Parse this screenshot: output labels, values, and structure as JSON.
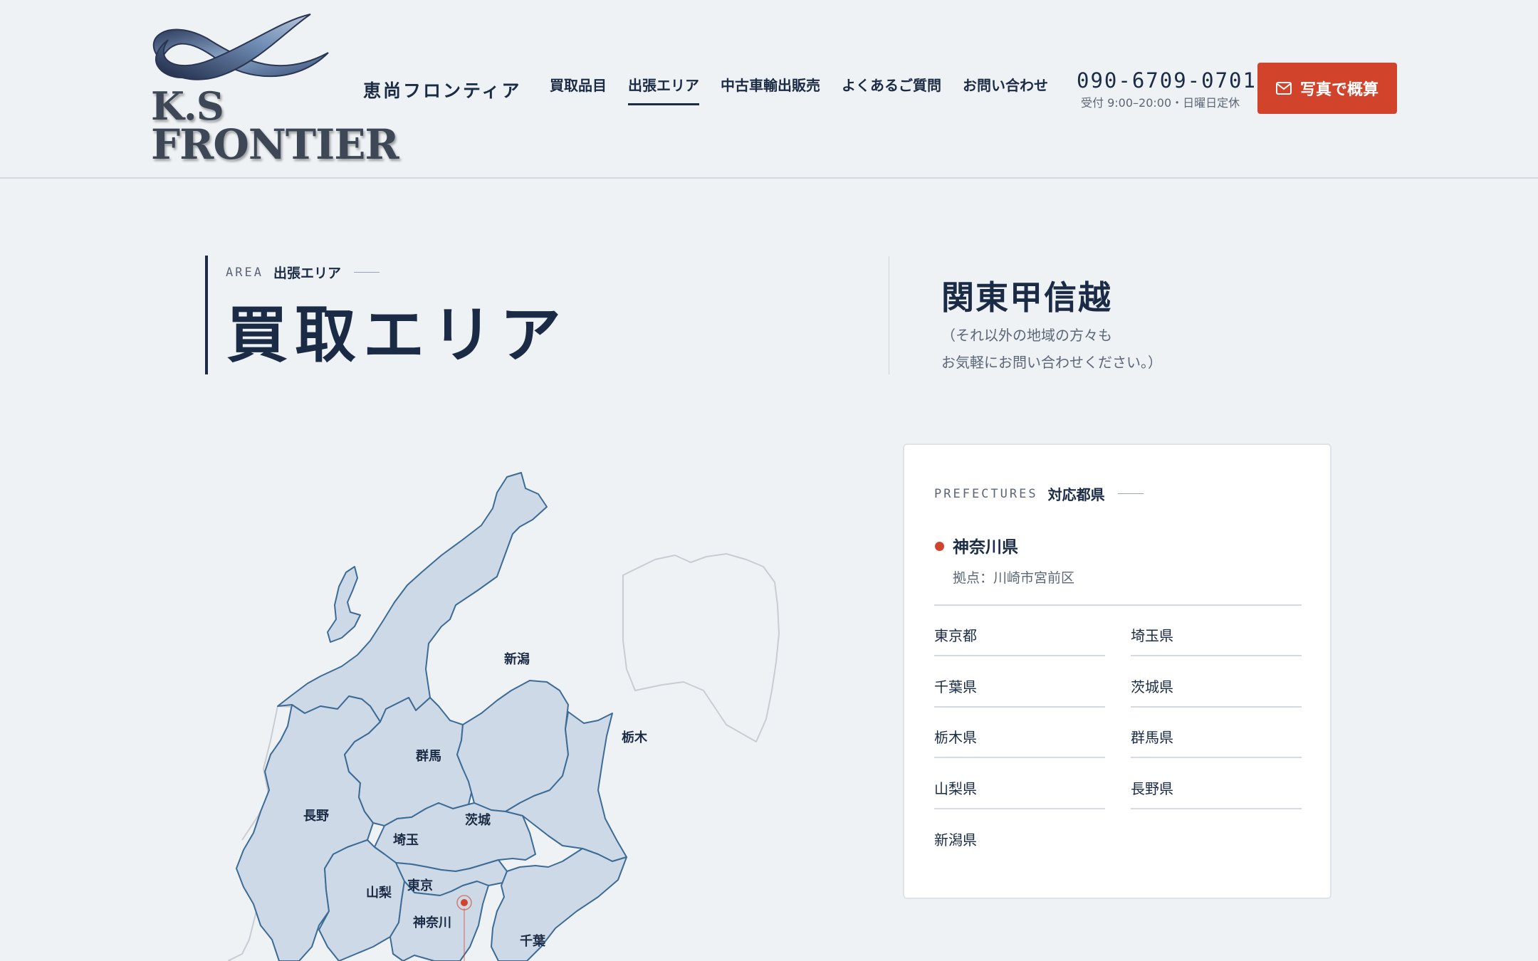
{
  "header": {
    "logo_line1": "K.S",
    "logo_line2": "FRONTIER",
    "brand_name": "恵尚フロンティア",
    "nav": [
      {
        "label": "買取品目",
        "active": false
      },
      {
        "label": "出張エリア",
        "active": true
      },
      {
        "label": "中古車輸出販売",
        "active": false
      },
      {
        "label": "よくあるご質問",
        "active": false
      },
      {
        "label": "お問い合わせ",
        "active": false
      }
    ],
    "phone": "090-6709-0701",
    "hours": "受付 9:00–20:00・日曜日定休",
    "cta_label": "写真で概算"
  },
  "hero": {
    "eyebrow_en": "AREA",
    "eyebrow_jp": "出張エリア",
    "title": "買取エリア",
    "region": "関東甲信越",
    "note_line1": "（それ以外の地域の方々も",
    "note_line2": "お気軽にお問い合わせください。）"
  },
  "map": {
    "labels": {
      "niigata": "新潟",
      "nagano": "長野",
      "gunma": "群馬",
      "tochigi": "栃木",
      "ibaraki": "茨城",
      "saitama": "埼玉",
      "yamanashi": "山梨",
      "tokyo": "東京",
      "kanagawa": "神奈川",
      "chiba": "千葉"
    },
    "marker_color": "#d2432b"
  },
  "card": {
    "eyebrow_en": "PREFECTURES",
    "eyebrow_jp": "対応都県",
    "base_name": "神奈川県",
    "base_location": "拠点：川崎市宮前区",
    "prefectures": [
      "東京都",
      "埼玉県",
      "千葉県",
      "茨城県",
      "栃木県",
      "群馬県",
      "山梨県",
      "長野県",
      "新潟県"
    ]
  },
  "colors": {
    "navy": "#1b2b45",
    "accent": "#d2432b",
    "map_fill": "#cdd9e6",
    "map_stroke": "#3c6b96",
    "background": "#eff2f5"
  }
}
